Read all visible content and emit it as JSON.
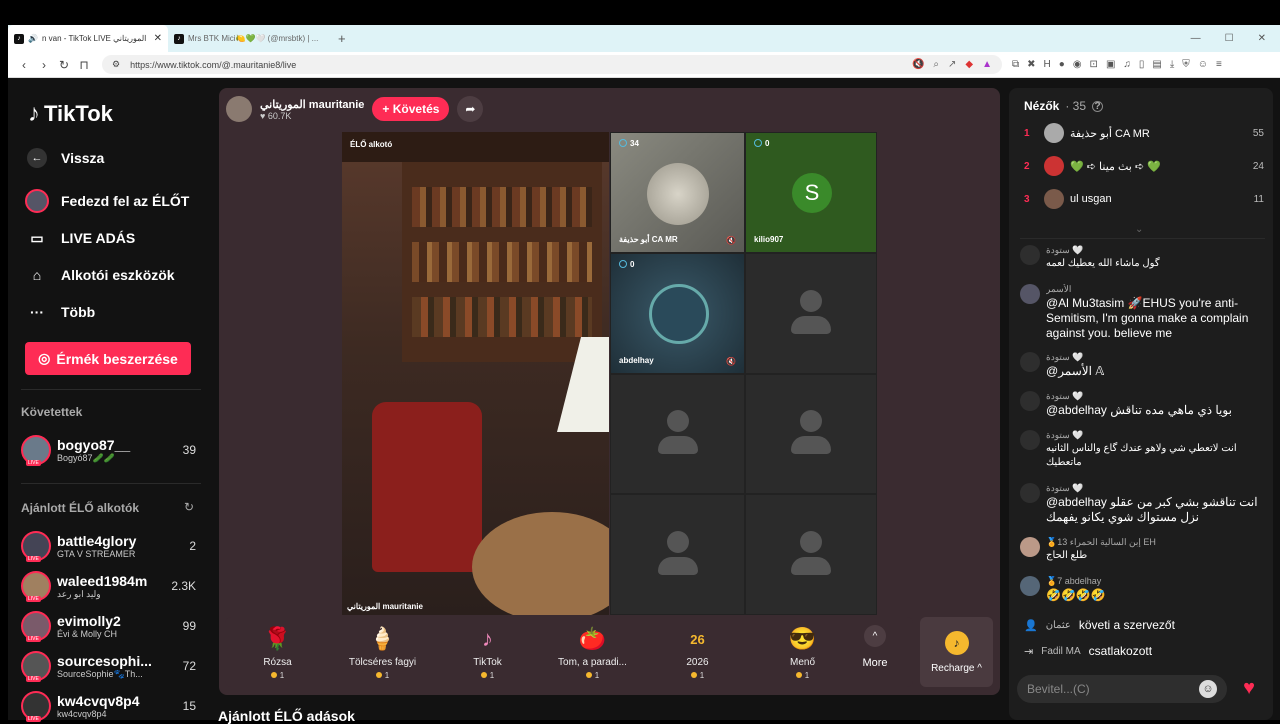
{
  "browser": {
    "tabs": [
      {
        "label": "n van - TikTok LIVE الموريتاني",
        "active": true
      },
      {
        "label": "Mrs BTK Mici🍋💚🤍 (@mrsbtk) | ...",
        "active": false
      }
    ],
    "url": "https://www.tiktok.com/@.mauritanie8/live"
  },
  "sidebar": {
    "logo": "TikTok",
    "back": "Vissza",
    "nav": [
      {
        "label": "Fedezd fel az ÉLŐT",
        "icon": "live-avatar-icon"
      },
      {
        "label": "LIVE ADÁS",
        "icon": "video-camera-icon"
      },
      {
        "label": "Alkotói eszközök",
        "icon": "creator-tools-icon"
      },
      {
        "label": "Több",
        "icon": "more-dots-icon"
      }
    ],
    "coin_button": "Érmék beszerzése",
    "following_header": "Követettek",
    "following": [
      {
        "name": "bogyo87__",
        "sub": "Bogyó87🥒🥒",
        "count": "39",
        "color": "#6a7a8a"
      }
    ],
    "recommended_header": "Ajánlott ÉLŐ alkotók",
    "recommended": [
      {
        "name": "battle4glory",
        "sub": "GTA V STREAMER",
        "count": "2",
        "color": "#445"
      },
      {
        "name": "waleed1984m",
        "sub": "وليد ابو رعد",
        "count": "2.3K",
        "color": "#a08060"
      },
      {
        "name": "evimolly2",
        "sub": "Évi & Molly CH",
        "count": "99",
        "color": "#7a5a6a"
      },
      {
        "name": "sourcesophi...",
        "sub": "SourceSophie🐾Th...",
        "count": "72",
        "color": "#555"
      },
      {
        "name": "kw4cvqv8p4",
        "sub": "kw4cvqv8p4",
        "count": "15",
        "color": "#333"
      }
    ],
    "live_badge": "LIVE"
  },
  "stream": {
    "host_name": "الموريتاني mauritanie",
    "host_likes": "60.7K",
    "follow_label": "+ Követés",
    "main_label": "ÉLŐ alkotó",
    "main_name": "الموريتاني mauritanie",
    "guests": [
      {
        "count": "34",
        "name": "أبو حذيفة CA MR",
        "muted": true,
        "type": "coin"
      },
      {
        "count": "0",
        "name": "kilio907",
        "muted": false,
        "type": "letter",
        "letter": "S"
      },
      {
        "count": "0",
        "name": "abdelhay",
        "muted": true,
        "type": "calligraphy"
      },
      {
        "type": "empty"
      },
      {
        "type": "empty"
      },
      {
        "type": "empty"
      },
      {
        "type": "empty"
      },
      {
        "type": "empty"
      }
    ]
  },
  "gifts": [
    {
      "name": "Rózsa",
      "price": "1",
      "icon": "rose-icon",
      "glyph": "🌹"
    },
    {
      "name": "Tölcséres fagyi",
      "price": "1",
      "icon": "ice-cream-icon",
      "glyph": "🍦"
    },
    {
      "name": "TikTok",
      "price": "1",
      "icon": "tiktok-gift-icon",
      "glyph": "♪"
    },
    {
      "name": "Tom, a paradi...",
      "price": "1",
      "icon": "tomato-icon",
      "glyph": "🍅"
    },
    {
      "name": "2026",
      "price": "1",
      "icon": "2026-gift-icon",
      "glyph": "26"
    },
    {
      "name": "Menő",
      "price": "1",
      "icon": "cool-face-icon",
      "glyph": "😎"
    }
  ],
  "more_label": "More",
  "recharge_label": "Recharge ^",
  "recommended_live_header": "Ajánlott ÉLŐ adások",
  "panel": {
    "viewers_label": "Nézők",
    "viewers_count": "· 35",
    "ranks": [
      {
        "rank": "1",
        "name": "أبو حذيفة CA MR",
        "score": "55",
        "color": "#aaa"
      },
      {
        "rank": "2",
        "name": "💚 ➪ بث مينا ➪ 💚",
        "score": "24",
        "color": "#c33"
      },
      {
        "rank": "3",
        "name": "ul usgan",
        "score": "11",
        "color": "#7a5a4a"
      }
    ],
    "chat": [
      {
        "user": "ستودة 🤍",
        "text": "گول ماشاء الله يعطيك لعمه"
      },
      {
        "user": "الأسمر",
        "text": "@Al Mu3tasim 🚀EHUS you're anti-Semitism, I'm gonna make a complain against you. believe me"
      },
      {
        "user": "ستودة 🤍",
        "text": "@الأسمر 𝔸"
      },
      {
        "user": "ستودة 🤍",
        "text": "@abdelhay بويا ذي ماهي مده تناقش"
      },
      {
        "user": "ستودة 🤍",
        "text": "انت لاتعطي شي ولاهو عندك گاع والناس الثانيه ماتعطيك"
      },
      {
        "user": "ستودة 🤍",
        "text": "@abdelhay انت تناقشو بشي كبر من عقلو نزل مستواك شوي يكانو يفهمك"
      },
      {
        "user": "🏅13 إبن السالية الحمراء EH",
        "text": "طلع الحاج"
      },
      {
        "user": "🏅7 abdelhay",
        "text": "🤣🤣🤣🤣"
      }
    ],
    "sys1_user": "عثمان",
    "sys1_text": "követi a szervezőt",
    "sys2_user": "Fadil MA",
    "sys2_text": "csatlakozott",
    "input_placeholder": "Bevitel...(C)"
  }
}
